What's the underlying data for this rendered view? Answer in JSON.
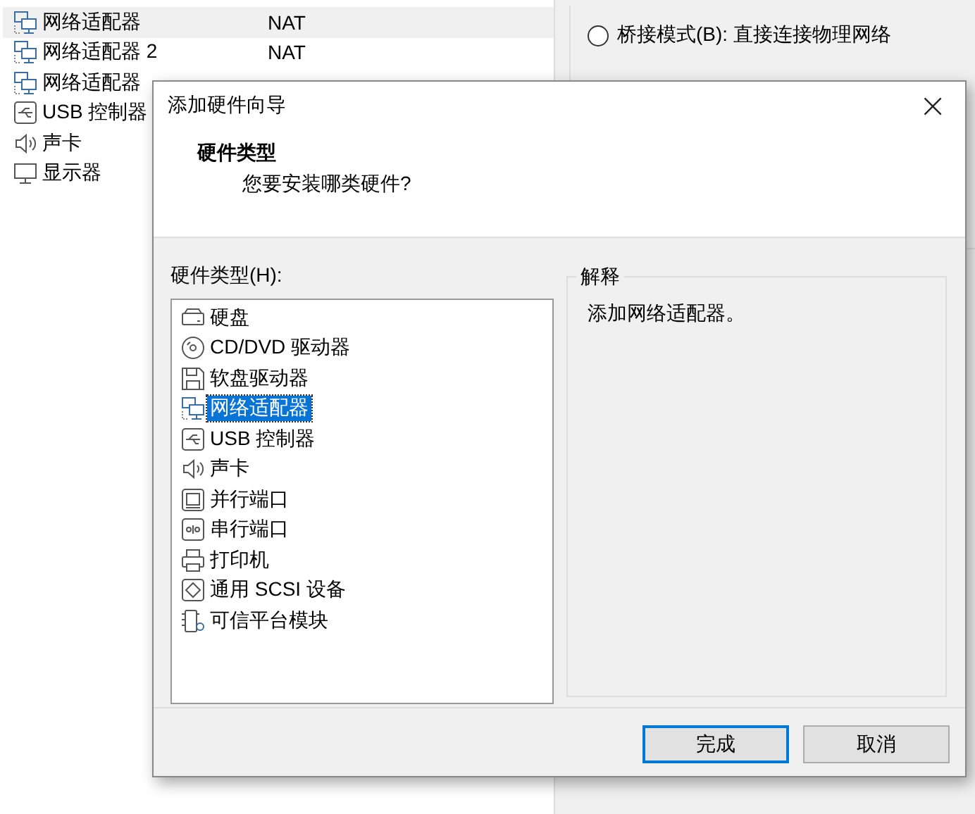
{
  "background": {
    "devices": [
      {
        "kind": "network",
        "name": "网络适配器",
        "value": "NAT",
        "selected": true
      },
      {
        "kind": "network",
        "name": "网络适配器 2",
        "value": "NAT",
        "selected": false
      },
      {
        "kind": "network",
        "name": "网络适配器",
        "selected": false
      },
      {
        "kind": "usb",
        "name": "USB 控制器",
        "selected": false
      },
      {
        "kind": "sound",
        "name": "声卡",
        "selected": false
      },
      {
        "kind": "display",
        "name": "显示器",
        "selected": false
      }
    ],
    "network_group": {
      "option": {
        "label": "桥接模式(B): 直接连接物理网络",
        "selected": false
      }
    }
  },
  "dialog": {
    "title": "添加硬件向导",
    "close": "×",
    "header": {
      "title": "硬件类型",
      "subtitle": "您要安装哪类硬件?"
    },
    "list_label": "硬件类型(H):",
    "items": [
      {
        "kind": "disk",
        "label": "硬盘",
        "selected": false
      },
      {
        "kind": "cdrom",
        "label": "CD/DVD 驱动器",
        "selected": false
      },
      {
        "kind": "floppy",
        "label": "软盘驱动器",
        "selected": false
      },
      {
        "kind": "network",
        "label": "网络适配器",
        "selected": true
      },
      {
        "kind": "usb",
        "label": "USB 控制器",
        "selected": false
      },
      {
        "kind": "sound",
        "label": "声卡",
        "selected": false
      },
      {
        "kind": "parallel",
        "label": "并行端口",
        "selected": false
      },
      {
        "kind": "serial",
        "label": "串行端口",
        "selected": false
      },
      {
        "kind": "printer",
        "label": "打印机",
        "selected": false
      },
      {
        "kind": "scsi",
        "label": "通用 SCSI 设备",
        "selected": false
      },
      {
        "kind": "tpm",
        "label": "可信平台模块",
        "selected": false
      }
    ],
    "explanation": {
      "title": "解释",
      "text": "添加网络适配器。"
    },
    "buttons": [
      {
        "label": "完成",
        "default": true
      },
      {
        "label": "取消",
        "default": false
      }
    ]
  }
}
